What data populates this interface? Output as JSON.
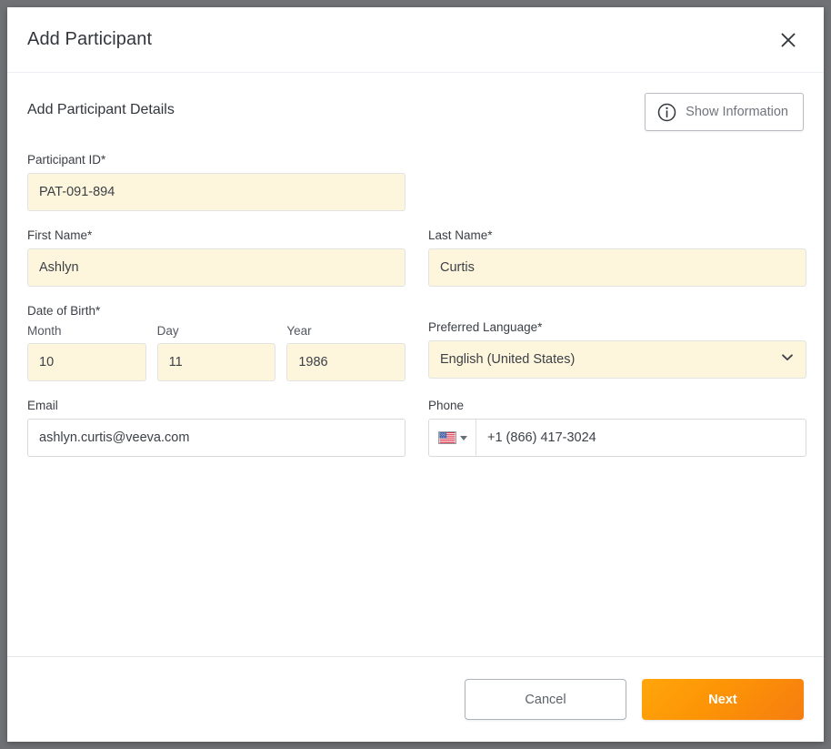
{
  "modal": {
    "title": "Add Participant",
    "close_icon": "close-icon"
  },
  "body": {
    "section_title": "Add Participant Details",
    "info_button": {
      "label": "Show Information",
      "icon": "info-circle-icon"
    },
    "fields": {
      "participant_id": {
        "label": "Participant ID*",
        "value": "PAT-091-894",
        "placeholder": ""
      },
      "first_name": {
        "label": "First Name*",
        "value": "Ashlyn",
        "placeholder": ""
      },
      "last_name": {
        "label": "Last Name*",
        "value": "Curtis",
        "placeholder": ""
      },
      "date_of_birth": {
        "label": "Date of Birth*",
        "month": {
          "label": "Month",
          "value": "10",
          "placeholder": ""
        },
        "day": {
          "label": "Day",
          "value": "11",
          "placeholder": ""
        },
        "year": {
          "label": "Year",
          "value": "1986",
          "placeholder": ""
        }
      },
      "preferred_language": {
        "label": "Preferred Language*",
        "value": "English (United States)",
        "chevron_icon": "chevron-down-icon"
      },
      "email": {
        "label": "Email",
        "value": "ashlyn.curtis@veeva.com",
        "placeholder": ""
      },
      "phone": {
        "label": "Phone",
        "country_flag": "us-flag-icon",
        "value": "+1 (866) 417-3024",
        "placeholder": ""
      }
    }
  },
  "footer": {
    "cancel_label": "Cancel",
    "next_label": "Next"
  },
  "colors": {
    "required_field_bg": "#FDF6DC",
    "primary_accent": "#FD9406",
    "modal_bg": "#FFFFFF",
    "page_backdrop": "#6F7175",
    "text_primary": "#32363C"
  }
}
